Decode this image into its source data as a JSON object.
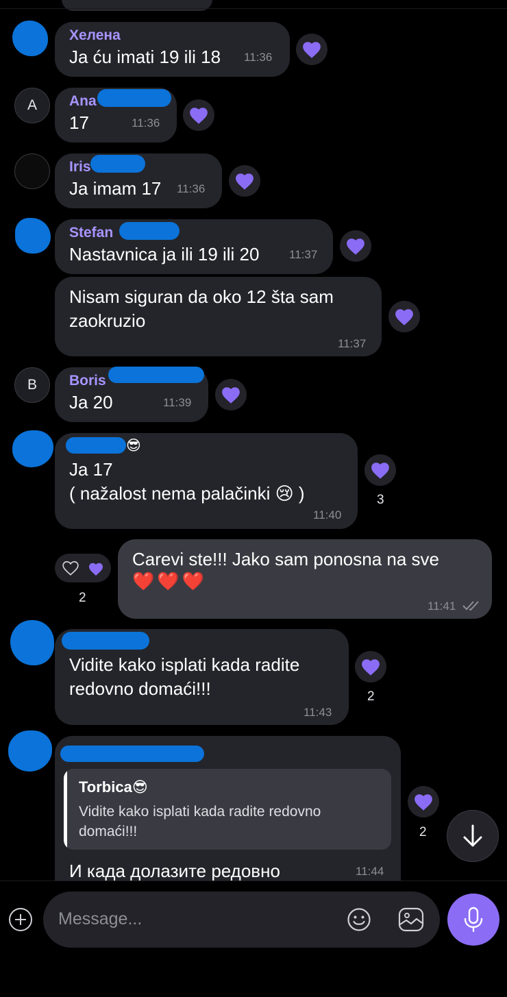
{
  "messages": {
    "m1": {
      "sender": "Хелена",
      "text": "Ja ću imati 19 ili 18",
      "time": "11:36"
    },
    "m2": {
      "sender": "Ana",
      "avatar_letter": "A",
      "text": "17",
      "time": "11:36"
    },
    "m3": {
      "sender": "Iris",
      "text": "Ja imam 17",
      "time": "11:36"
    },
    "m4": {
      "sender": "Stefan",
      "text": "Nastavnica ja ili 19 ili 20",
      "time": "11:37"
    },
    "m5": {
      "text": "Nisam siguran da oko 12 šta sam\nzaokruzio",
      "time": "11:37"
    },
    "m6": {
      "sender": "Boris",
      "avatar_letter": "B",
      "text": "Ja 20",
      "time": "11:39"
    },
    "m7": {
      "sender_emoji": "😎",
      "text": "Ja 17\n( nažalost  nema palačinki 😢 )",
      "time": "11:40",
      "reaction_count": "3"
    },
    "m8": {
      "text": "Carevi ste!!! Jako sam ponosna na sve",
      "emoji_line": "❤️❤️❤️",
      "time": "11:41",
      "reaction_count": "2"
    },
    "m9": {
      "text": "Vidite kako isplati kada radite\nredovno domaći!!!",
      "time": "11:43",
      "reaction_count": "2"
    },
    "m10": {
      "quote_sender": "Torbica😎",
      "quote_text": "Vidite kako isplati kada radite redovno\ndomaći!!!",
      "text": "И када долазите редовно",
      "time": "11:44",
      "reaction_count": "2"
    }
  },
  "composer": {
    "placeholder": "Message..."
  },
  "colors": {
    "accent": "#8b6cf5",
    "bubble": "#24252b",
    "own_bubble": "#3a3b42",
    "name": "#a894ff",
    "redaction": "#0b73d9"
  },
  "icons": [
    "heart-icon",
    "plus-icon",
    "emoji-icon",
    "gallery-icon",
    "mic-icon",
    "arrow-down-icon",
    "double-check-icon"
  ]
}
